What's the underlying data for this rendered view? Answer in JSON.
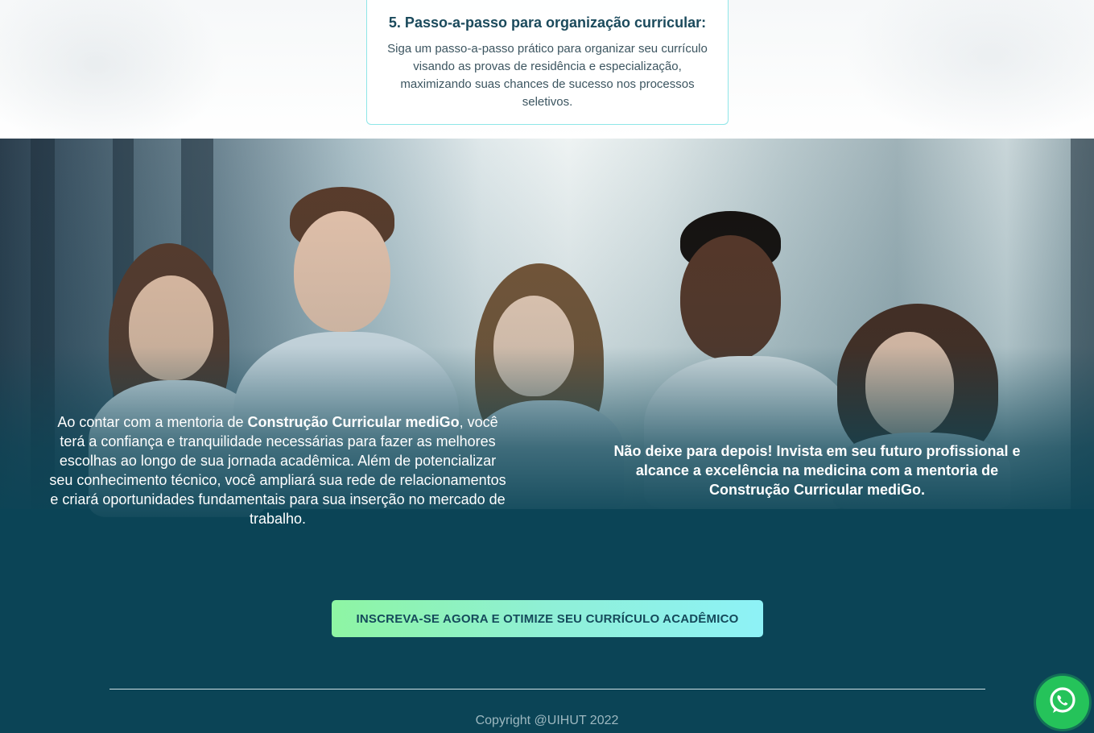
{
  "step_card": {
    "title": "5. Passo-a-passo para organização curricular:",
    "description": "Siga um passo-a-passo prático para organizar seu currículo visando as provas de residência e especialização, maximizando suas chances de sucesso nos processos seletivos."
  },
  "hero": {
    "left_text_prefix": "Ao contar com a mentoria de ",
    "left_text_brand": "Construção Curricular mediGo",
    "left_text_suffix": ", você terá a confiança e tranquilidade necessárias para fazer as melhores escolhas ao longo de sua jornada acadêmica. Além de potencializar seu conhecimento técnico, você ampliará sua rede de relacionamentos e criará oportunidades fundamentais para sua inserção no mercado de trabalho.",
    "right_text": "Não deixe para depois! Invista em seu futuro profissional e alcance a excelência na medicina com a mentoria de Construção Curricular mediGo."
  },
  "cta": {
    "label": "INSCREVA-SE AGORA E OTIMIZE SEU CURRÍCULO ACADÊMICO"
  },
  "footer": {
    "copyright": "Copyright @UIHUT 2022"
  },
  "floating": {
    "icon": "whatsapp-icon"
  },
  "colors": {
    "accent_teal": "#0b4456",
    "cta_gradient_start": "#8ef5a3",
    "cta_gradient_end": "#8ef2f7",
    "whatsapp_green": "#25c35a",
    "card_border": "#8fe6e8"
  }
}
